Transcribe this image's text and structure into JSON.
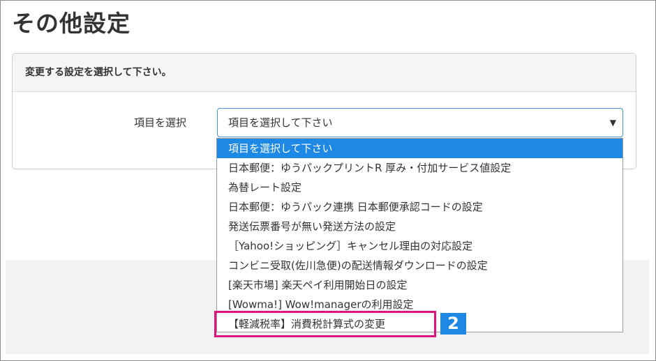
{
  "page": {
    "title": "その他設定"
  },
  "panel": {
    "heading": "変更する設定を選択して下さい。",
    "field_label": "項目を選択",
    "select_value": "項目を選択して下さい",
    "arrow": "▼"
  },
  "dropdown": {
    "options": [
      "項目を選択して下さい",
      "日本郵便：ゆうパックプリントR 厚み・付加サービス値設定",
      "為替レート設定",
      "日本郵便：ゆうパック連携 日本郵便承認コードの設定",
      "発送伝票番号が無い発送方法の設定",
      "［Yahoo!ショッピング］キャンセル理由の対応設定",
      "コンビニ受取(佐川急便)の配送情報ダウンロードの設定",
      "[楽天市場] 楽天ペイ利用開始日の設定",
      "[Wowma!] Wow!managerの利用設定",
      "【軽減税率】消費税計算式の変更"
    ],
    "selected_index": 0
  },
  "annotation": {
    "step_number": "2",
    "highlight_color": "#e0137a",
    "badge_color": "#1e88e5"
  }
}
